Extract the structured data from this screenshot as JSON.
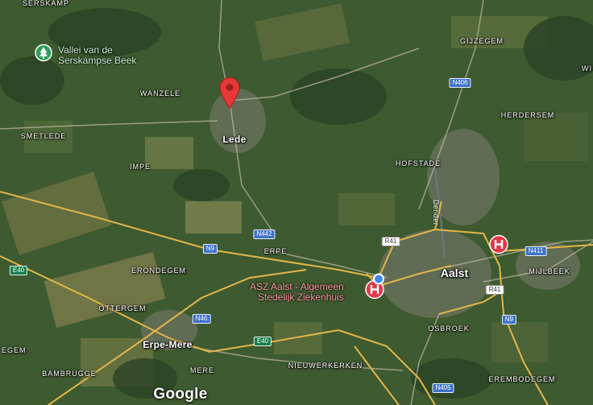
{
  "map": {
    "type": "satellite",
    "attribution": "Google"
  },
  "colors": {
    "road_primary": "#e3b64a",
    "road_secondary": "#b9b6a2",
    "pin": "#e53935",
    "hospital": "#e0394a",
    "park": "#2d9d5c",
    "location_dot": "#4285f4"
  },
  "places": [
    {
      "id": "serskamp",
      "label": "SERSKAMP",
      "kind": "village"
    },
    {
      "id": "wanzele",
      "label": "WANZELE",
      "kind": "village"
    },
    {
      "id": "smetlede",
      "label": "SMETLEDE",
      "kind": "village"
    },
    {
      "id": "impe",
      "label": "IMPE",
      "kind": "village"
    },
    {
      "id": "lede",
      "label": "Lede",
      "kind": "town"
    },
    {
      "id": "gijzegem",
      "label": "GIJZEGEM",
      "kind": "village"
    },
    {
      "id": "herdersem",
      "label": "HERDERSEM",
      "kind": "village"
    },
    {
      "id": "hofstade",
      "label": "HOFSTADE",
      "kind": "village"
    },
    {
      "id": "erpe",
      "label": "ERPE",
      "kind": "village"
    },
    {
      "id": "erondegem",
      "label": "ERONDEGEM",
      "kind": "village"
    },
    {
      "id": "ottergem",
      "label": "OTTERGEM",
      "kind": "village"
    },
    {
      "id": "erpe_mere",
      "label": "Erpe-Mere",
      "kind": "town"
    },
    {
      "id": "aalst",
      "label": "Aalst",
      "kind": "city"
    },
    {
      "id": "mijlbeek",
      "label": "MIJLBEEK",
      "kind": "village"
    },
    {
      "id": "osbroek",
      "label": "OSBROEK",
      "kind": "village"
    },
    {
      "id": "nieuwerkerken",
      "label": "NIEUWERKERKEN",
      "kind": "village"
    },
    {
      "id": "mere",
      "label": "MERE",
      "kind": "village"
    },
    {
      "id": "bambrugge",
      "label": "BAMBRUGGE",
      "kind": "village"
    },
    {
      "id": "erembodegem",
      "label": "EREMBODEGEM",
      "kind": "village"
    },
    {
      "id": "wi",
      "label": "WI",
      "kind": "village"
    },
    {
      "id": "egem",
      "label": "EGEM",
      "kind": "village"
    }
  ],
  "road_shields": [
    {
      "id": "n406",
      "label": "N406",
      "style": "blue"
    },
    {
      "id": "n442",
      "label": "N442",
      "style": "blue"
    },
    {
      "id": "n9_west",
      "label": "N9",
      "style": "blue"
    },
    {
      "id": "n9_east",
      "label": "N9",
      "style": "blue"
    },
    {
      "id": "n46",
      "label": "N46",
      "style": "blue"
    },
    {
      "id": "n411",
      "label": "N411",
      "style": "blue"
    },
    {
      "id": "n405",
      "label": "N405",
      "style": "blue"
    },
    {
      "id": "r41_north",
      "label": "R41",
      "style": "white"
    },
    {
      "id": "r41_east",
      "label": "R41",
      "style": "white"
    },
    {
      "id": "e40_west",
      "label": "E40",
      "style": "green"
    },
    {
      "id": "e40_mid",
      "label": "E40",
      "style": "green"
    }
  ],
  "waterway": {
    "label": "Dender"
  },
  "pois": {
    "park": {
      "line1": "Vallei van de",
      "line2": "Serskampse Beek",
      "icon": "tree-icon"
    },
    "hospital_main": {
      "line1": "ASZ Aalst - Algemeen",
      "line2": "Stedelijk Ziekenhuis",
      "icon": "hospital-icon"
    },
    "hospital_east": {
      "icon": "hospital-icon"
    }
  },
  "pin": {
    "icon": "map-pin-icon",
    "place": "Lede"
  }
}
